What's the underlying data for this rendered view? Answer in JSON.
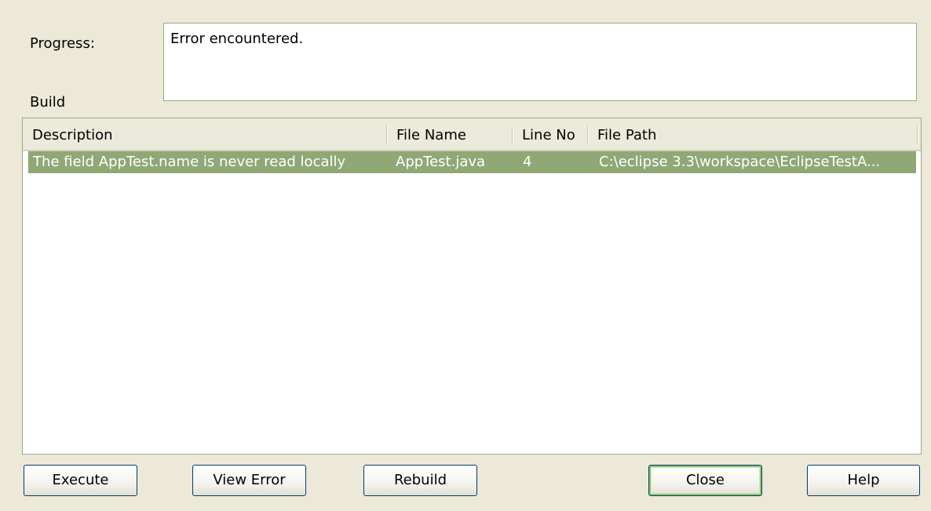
{
  "progress": {
    "label": "Progress:",
    "text": "Error encountered."
  },
  "build": {
    "label": "Build"
  },
  "table": {
    "columns": [
      "Description",
      "File Name",
      "Line No",
      "File Path"
    ],
    "rows": [
      {
        "description": "The field AppTest.name is never read locally",
        "file_name": "AppTest.java",
        "line_no": "4",
        "file_path": "C:\\eclipse 3.3\\workspace\\EclipseTestA..."
      }
    ],
    "selection_color": "#8fa876"
  },
  "buttons": {
    "execute": "Execute",
    "view_error": "View Error",
    "rebuild": "Rebuild",
    "close": "Close",
    "help": "Help"
  }
}
